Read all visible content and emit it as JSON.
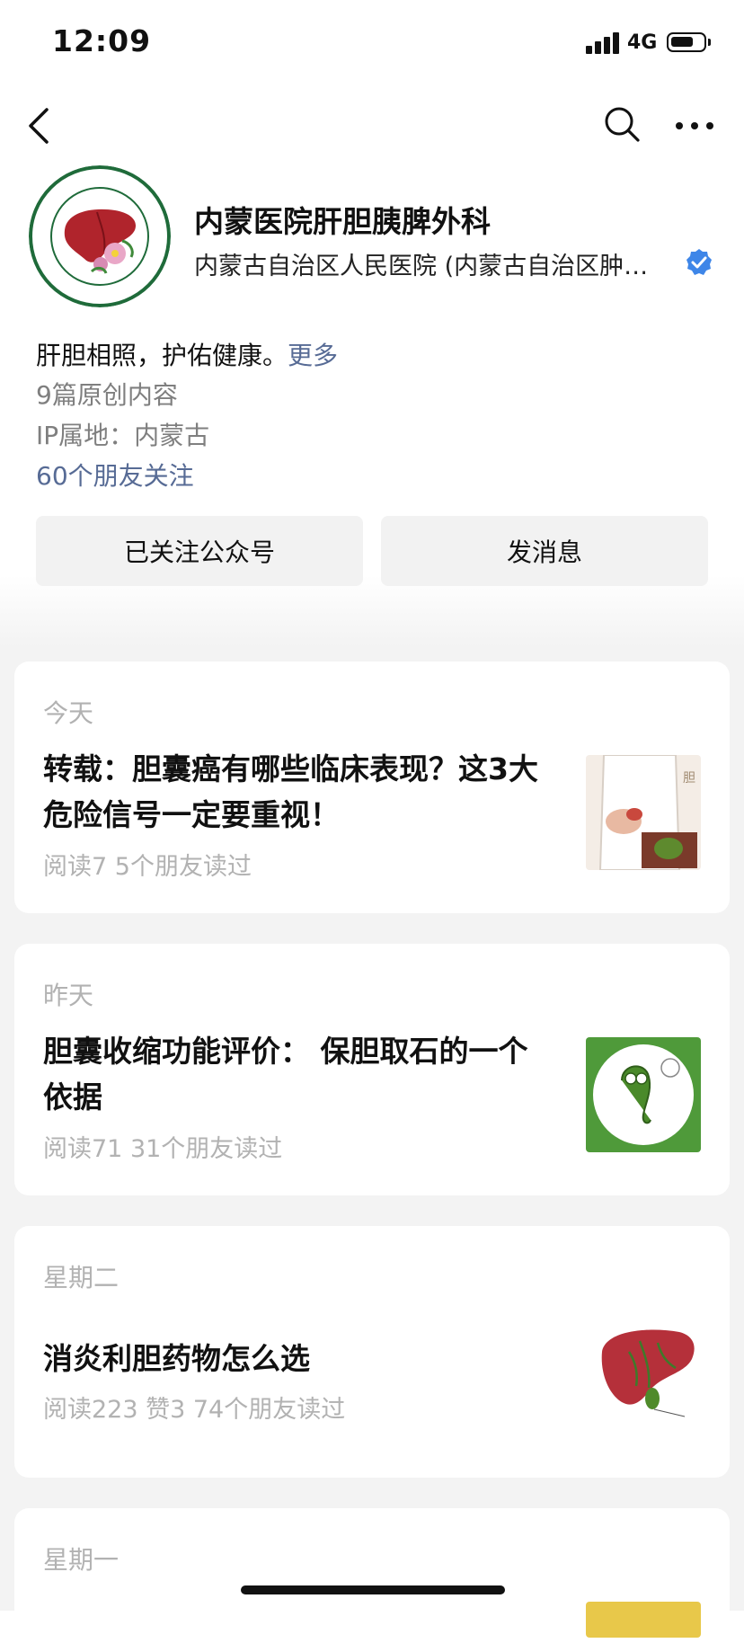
{
  "status_bar": {
    "time": "12:09",
    "network": "4G"
  },
  "account": {
    "name": "内蒙医院肝胆胰脾外科",
    "org": "内蒙古自治区人民医院 (内蒙古自治区肿…",
    "bio": "肝胆相照，护佑健康。",
    "bio_more": "更多",
    "original_count": "9篇原创内容",
    "ip_location": "IP属地：内蒙古",
    "friends_following": "60个朋友关注"
  },
  "actions": {
    "followed": "已关注公众号",
    "message": "发消息"
  },
  "articles": [
    {
      "day": "今天",
      "title": "转载：胆囊癌有哪些临床表现？这3大危险信号一定要重视！",
      "stats": "阅读7  5个朋友读过"
    },
    {
      "day": "昨天",
      "title": "胆囊收缩功能评价： 保胆取石的一个依据",
      "stats": "阅读71  31个朋友读过"
    },
    {
      "day": "星期二",
      "title": "消炎利胆药物怎么选",
      "stats": "阅读223  赞3  74个朋友读过"
    },
    {
      "day": "星期一"
    }
  ],
  "colors": {
    "link": "#576b95",
    "muted": "#b2b2b2",
    "verified": "#3e86e8",
    "logo_green": "#1f6b3a"
  }
}
